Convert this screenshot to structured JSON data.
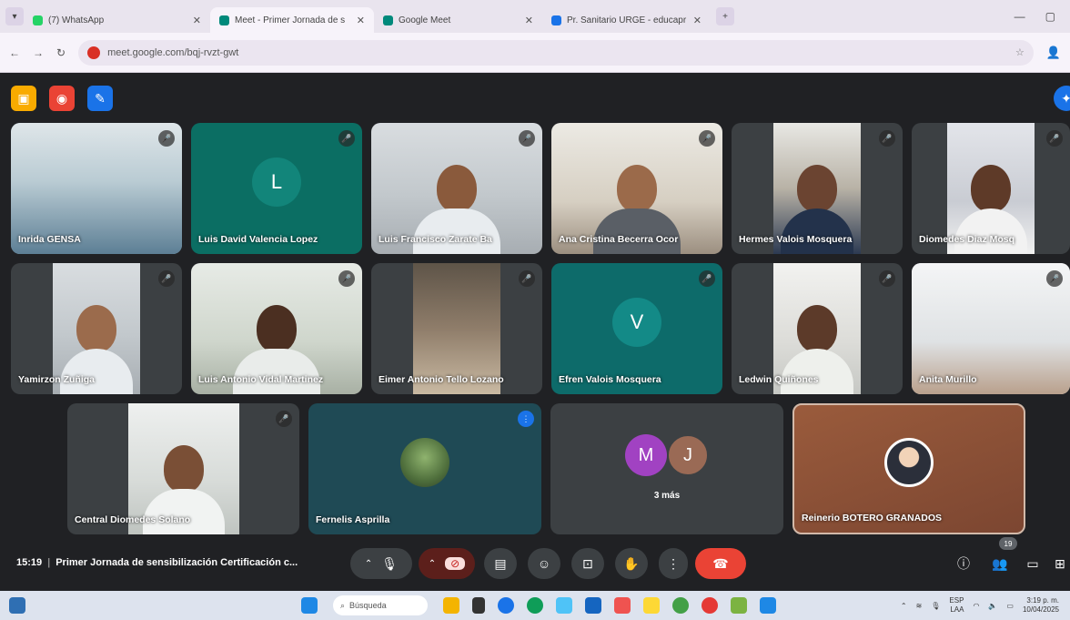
{
  "browser": {
    "tabs": [
      {
        "label": "(7) WhatsApp",
        "color": "#25d366"
      },
      {
        "label": "Meet - Primer Jornada de s",
        "color": "#00897b"
      },
      {
        "label": "Google Meet",
        "color": "#00897b"
      },
      {
        "label": "Pr. Sanitario URGE - educapr",
        "color": "#1a73e8"
      }
    ],
    "url": "meet.google.com/bqj-rvzt-gwt",
    "window_controls": [
      "—",
      "▢"
    ]
  },
  "meet": {
    "top_buttons": [
      {
        "name": "activities",
        "color": "#f9ab00",
        "glyph": "▣"
      },
      {
        "name": "recording",
        "color": "#ea4335",
        "glyph": "◉"
      },
      {
        "name": "notes",
        "color": "#1a73e8",
        "glyph": "✎"
      }
    ],
    "tiles": [
      {
        "name": "Inrida GENSA",
        "kind": "photo",
        "bg": "#8fb7c9"
      },
      {
        "name": "Luis David Valencia Lopez",
        "kind": "avatar",
        "letter": "L",
        "bg": "#0b6e63",
        "avatar_color": "#12857a"
      },
      {
        "name": "Luis Francisco Zarate Ba",
        "kind": "photo",
        "bg": "#c9cdd0"
      },
      {
        "name": "Ana Cristina Becerra Ocor",
        "kind": "photo",
        "bg": "#d9d3c7"
      },
      {
        "name": "Hermes Valois Mosquera",
        "kind": "photo",
        "bg": "#3c4043"
      },
      {
        "name": "Diomedes Diaz Mosq",
        "kind": "photo",
        "bg": "#3c4043"
      },
      {
        "name": "Yamirzon Zuñiga",
        "kind": "photo",
        "bg": "#3c4043"
      },
      {
        "name": "Luis Antonio Vidal Martinez",
        "kind": "photo",
        "bg": "#d3d6d2"
      },
      {
        "name": "Eimer Antonio Tello Lozano",
        "kind": "photo",
        "bg": "#3c4043"
      },
      {
        "name": "Efren Valois Mosquera",
        "kind": "avatar",
        "letter": "V",
        "bg": "#0d6b6a",
        "avatar_color": "#138a87"
      },
      {
        "name": "Ledwin Quiñones",
        "kind": "photo",
        "bg": "#3c4043"
      },
      {
        "name": "Anita Murillo",
        "kind": "photo",
        "bg": "#e4e6e8"
      },
      {
        "name": "Central Diomedes Solano",
        "kind": "photo",
        "bg": "#3c4043"
      },
      {
        "name": "Fernelis Asprilla",
        "kind": "avatar-photo",
        "bg": "#1f4a55"
      },
      {
        "name": "3 más",
        "kind": "group",
        "bg": "#3c4043",
        "letters": [
          "M",
          "J"
        ],
        "colors": [
          "#a142c2",
          "#9a6a55"
        ]
      },
      {
        "name": "Reinerio BOTERO GRANADOS",
        "kind": "avatar-photo",
        "bg": "#8a5138"
      }
    ],
    "footer": {
      "time": "15:19",
      "meeting_title": "Primer Jornada de sensibilización Certificación c...",
      "participants_count": "19"
    }
  },
  "taskbar": {
    "search_placeholder": "Búsqueda",
    "language_top": "ESP",
    "language_bottom": "LAA",
    "time": "3:19 p. m.",
    "date": "10/04/2025"
  }
}
